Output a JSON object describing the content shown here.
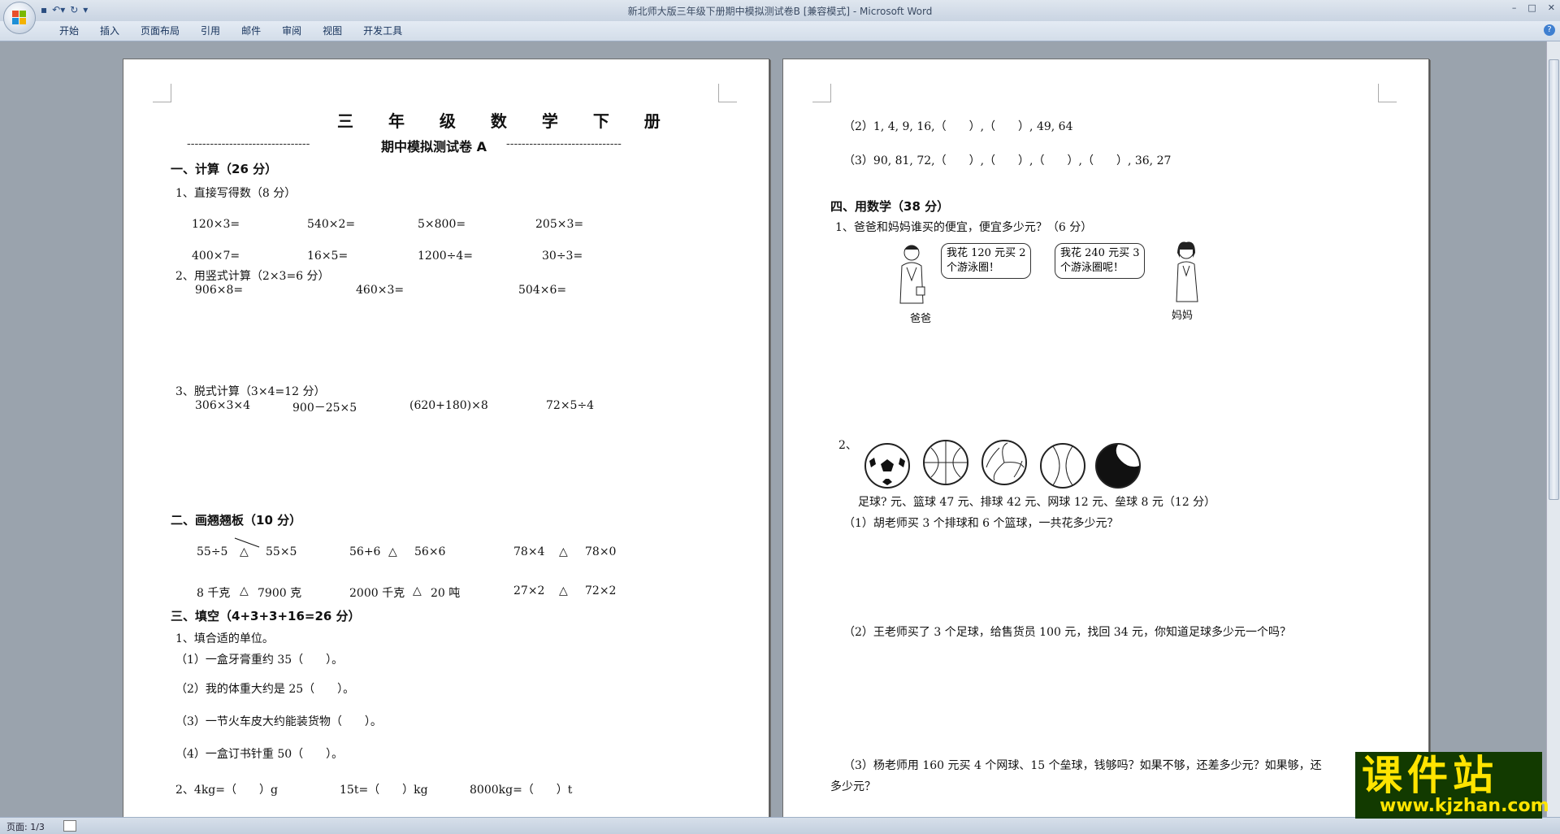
{
  "app": {
    "window_title": "新北师大版三年级下册期中模拟测试卷B [兼容模式] - Microsoft Word",
    "tabs": [
      "开始",
      "插入",
      "页面布局",
      "引用",
      "邮件",
      "审阅",
      "视图",
      "开发工具"
    ],
    "status_page": "页面: 1/3",
    "help": "?"
  },
  "watermark": {
    "main": "课件站",
    "url": "www.kjzhan.com"
  },
  "page1": {
    "title": "三 年 级 数 学 下 册",
    "subtitle_dashes_left": "--------------------------------",
    "subtitle": "期中模拟测试卷 A",
    "subtitle_dashes_right": "------------------------------",
    "s1": "一、计算（26 分）",
    "s1_q1": "1、直接写得数（8 分）",
    "r1": [
      "120×3=",
      "540×2=",
      "5×800=",
      "205×3="
    ],
    "r2": [
      "400×7=",
      "16×5=",
      "1200÷4=",
      "30÷3="
    ],
    "s1_q2": "2、用竖式计算（2×3=6 分）",
    "r3": [
      "906×8=",
      "460×3=",
      "504×6="
    ],
    "s1_q3": "3、脱式计算（3×4=12 分）",
    "r4": [
      "306×3×4",
      "900－25×5",
      "(620+180)×8",
      "72×5÷4"
    ],
    "s2": "二、画翘翘板（10 分）",
    "r5": [
      "55÷5",
      "55×5",
      "56+6",
      "56×6",
      "78×4",
      "78×0"
    ],
    "r6": [
      "8 千克",
      "7900 克",
      "2000 千克",
      "20 吨",
      "27×2",
      "72×2"
    ],
    "triangle": "△",
    "s3": "三、填空（4+3+3+16=26 分）",
    "s3_q1": "1、填合适的单位。",
    "f1": "（1）一盒牙膏重约 35（　　）。",
    "f2": "（2）我的体重大约是 25（　　）。",
    "f3": "（3）一节火车皮大约能装货物（　　）。",
    "f4": "（4）一盒订书针重 50（　　）。",
    "f5": [
      "2、4kg=（　　）g",
      "15t=（　　）kg",
      "8000kg=（　　）t"
    ]
  },
  "page2": {
    "seq2": "（2）1, 4, 9, 16,（　　）,（　　）, 49, 64",
    "seq3": "（3）90, 81, 72,（　　）,（　　）,（　　）,（　　）, 36, 27",
    "s4": "四、用数学（38 分）",
    "q1": "1、爸爸和妈妈谁买的便宜，便宜多少元？（6 分）",
    "bubble_dad": [
      "我花 120 元买 2",
      "个游泳圈！"
    ],
    "bubble_mom": [
      "我花 240 元买 3",
      "个游泳圈呢！"
    ],
    "dad": "爸爸",
    "mom": "妈妈",
    "q2": "2、",
    "prices": "足球? 元、篮球 47 元、排球 42 元、网球 12 元、垒球 8 元（12 分）",
    "sub1": "（1）胡老师买 3 个排球和 6 个篮球，一共花多少元？",
    "sub2": "（2）王老师买了 3 个足球，给售货员 100 元，找回 34 元，你知道足球多少元一个吗？",
    "sub3a": "（3）杨老师用 160 元买 4 个网球、15 个垒球，钱够吗？如果不够，还差多少元？如果够，还",
    "sub3b": "多少元？"
  },
  "colors": {
    "accent": "#2b579a",
    "watermark_yellow": "#ffe400"
  }
}
